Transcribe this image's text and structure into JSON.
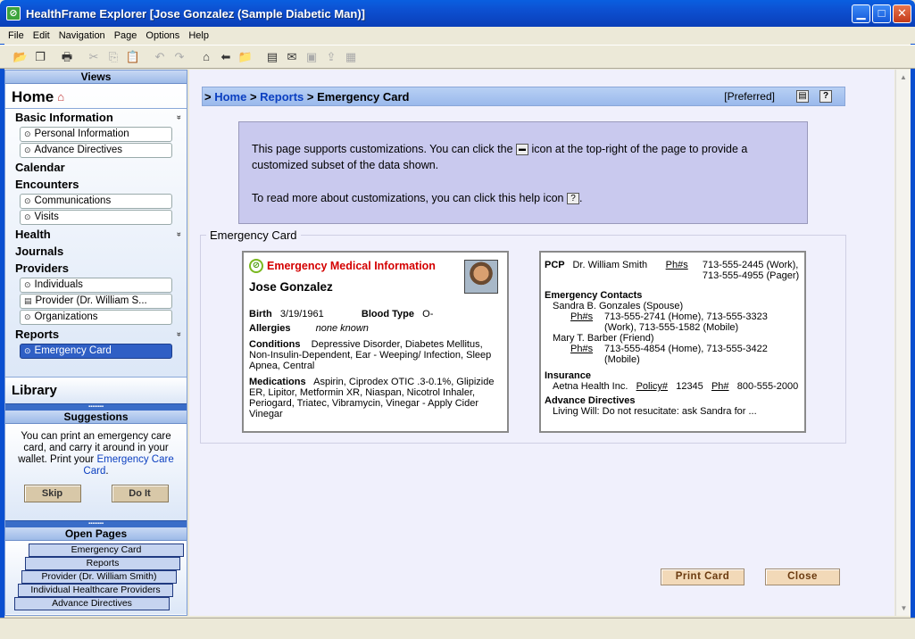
{
  "window": {
    "title": "HealthFrame Explorer [Jose Gonzalez (Sample Diabetic Man)]",
    "app_icon_glyph": "⊘"
  },
  "window_buttons": {
    "minimize": "▁",
    "maximize": "□",
    "close": "✕"
  },
  "menu": [
    "File",
    "Edit",
    "Navigation",
    "Page",
    "Options",
    "Help"
  ],
  "toolbar_icons": [
    "open-folder-icon",
    "copy-pages-icon",
    "print-icon",
    "cut-icon",
    "copy-icon",
    "paste-icon",
    "undo-icon",
    "redo-icon",
    "home-icon",
    "back-arrow-icon",
    "folder-icon",
    "notes-icon",
    "inbox-icon",
    "save-icon",
    "export-icon",
    "layout-icon"
  ],
  "toolbar_glyphs": [
    "📂",
    "❐",
    "🖶",
    "✂",
    "⎘",
    "📋",
    "↶",
    "↷",
    "⌂",
    "⬅",
    "📁",
    "▤",
    "✉",
    "▣",
    "⇪",
    "▦"
  ],
  "sidebar": {
    "views_header": "Views",
    "home_label": "Home",
    "home_icon_glyph": "⌂",
    "chevron_glyph": "»",
    "bullet_glyph": "⊙",
    "doc_glyph": "▤",
    "sections": {
      "basic_information": "Basic Information",
      "calendar": "Calendar",
      "encounters": "Encounters",
      "health": "Health",
      "journals": "Journals",
      "providers": "Providers",
      "reports": "Reports"
    },
    "items": {
      "personal_information": "Personal Information",
      "advance_directives": "Advance Directives",
      "communications": "Communications",
      "visits": "Visits",
      "individuals": "Individuals",
      "provider_william": "Provider (Dr. William S...",
      "organizations": "Organizations",
      "emergency_card": "Emergency Card"
    },
    "library_label": "Library",
    "grip_glyph": "▪▪▪▪▪▪▪▪",
    "suggestions_header": "Suggestions",
    "suggestion_text": "You can print an emergency care card, and carry it around in your wallet. Print your",
    "suggestion_link": "Emergency Care Card",
    "suggestion_end": ".",
    "skip_label": "Skip",
    "doit_label": "Do It",
    "open_pages_header": "Open Pages",
    "open_pages": [
      "Emergency Card",
      "Reports",
      "Provider (Dr. William Smith)",
      "Individual Healthcare Providers",
      "Advance Directives"
    ]
  },
  "breadcrumb": {
    "prefix": "> ",
    "home": "Home",
    "sep": " > ",
    "reports": "Reports",
    "current": "Emergency Card",
    "preferred": "[Preferred]",
    "custom_icon_glyph": "▤",
    "help_icon_glyph": "?"
  },
  "info": {
    "line1_before": "This page supports customizations. You can click the",
    "mini_icon_glyph": "▬",
    "line1_after": "icon at the top-right of the page to provide a customized subset of the data shown.",
    "line2": "To read more about customizations, you can click this help icon",
    "help_glyph": "?",
    "line2_end": "."
  },
  "group_title": "Emergency Card",
  "card_left": {
    "heading": "Emergency Medical Information",
    "icon_glyph": "⊘",
    "name": "Jose Gonzalez",
    "birth_label": "Birth",
    "birth_value": "3/19/1961",
    "blood_label": "Blood Type",
    "blood_value": "O-",
    "allergies_label": "Allergies",
    "allergies_value": "none known",
    "conditions_label": "Conditions",
    "conditions_value": "Depressive Disorder, Diabetes Mellitus, Non-Insulin-Dependent, Ear - Weeping/ Infection, Sleep Apnea, Central",
    "medications_label": "Medications",
    "medications_value": "Aspirin, Ciprodex OTIC .3-0.1%, Glipizide ER, Lipitor, Metformin XR, Niaspan, Nicotrol Inhaler, Periogard, Triatec, Vibramycin, Vinegar - Apply Cider Vinegar"
  },
  "card_right": {
    "pcp_label": "PCP",
    "pcp_name": "Dr. William Smith",
    "phs_label": "Ph#s",
    "pcp_phones": "713-555-2445 (Work), 713-555-4955 (Pager)",
    "contacts_label": "Emergency Contacts",
    "contact1_name": "Sandra B. Gonzales (Spouse)",
    "contact1_phones": "713-555-2741 (Home), 713-555-3323 (Work), 713-555-1582 (Mobile)",
    "contact2_name": "Mary T. Barber (Friend)",
    "contact2_phones": "713-555-4854 (Home), 713-555-3422 (Mobile)",
    "insurance_label": "Insurance",
    "insurance_name": "Aetna Health Inc.",
    "policy_label": "Policy#",
    "policy_value": "12345",
    "ph_label": "Ph#",
    "insurance_phone": "800-555-2000",
    "directives_label": "Advance Directives",
    "directives_value": "Living Will: Do not resucitate: ask Sandra for ..."
  },
  "buttons": {
    "print_card": "Print Card",
    "close": "Close"
  },
  "scroll": {
    "up": "▲",
    "down": "▼"
  }
}
